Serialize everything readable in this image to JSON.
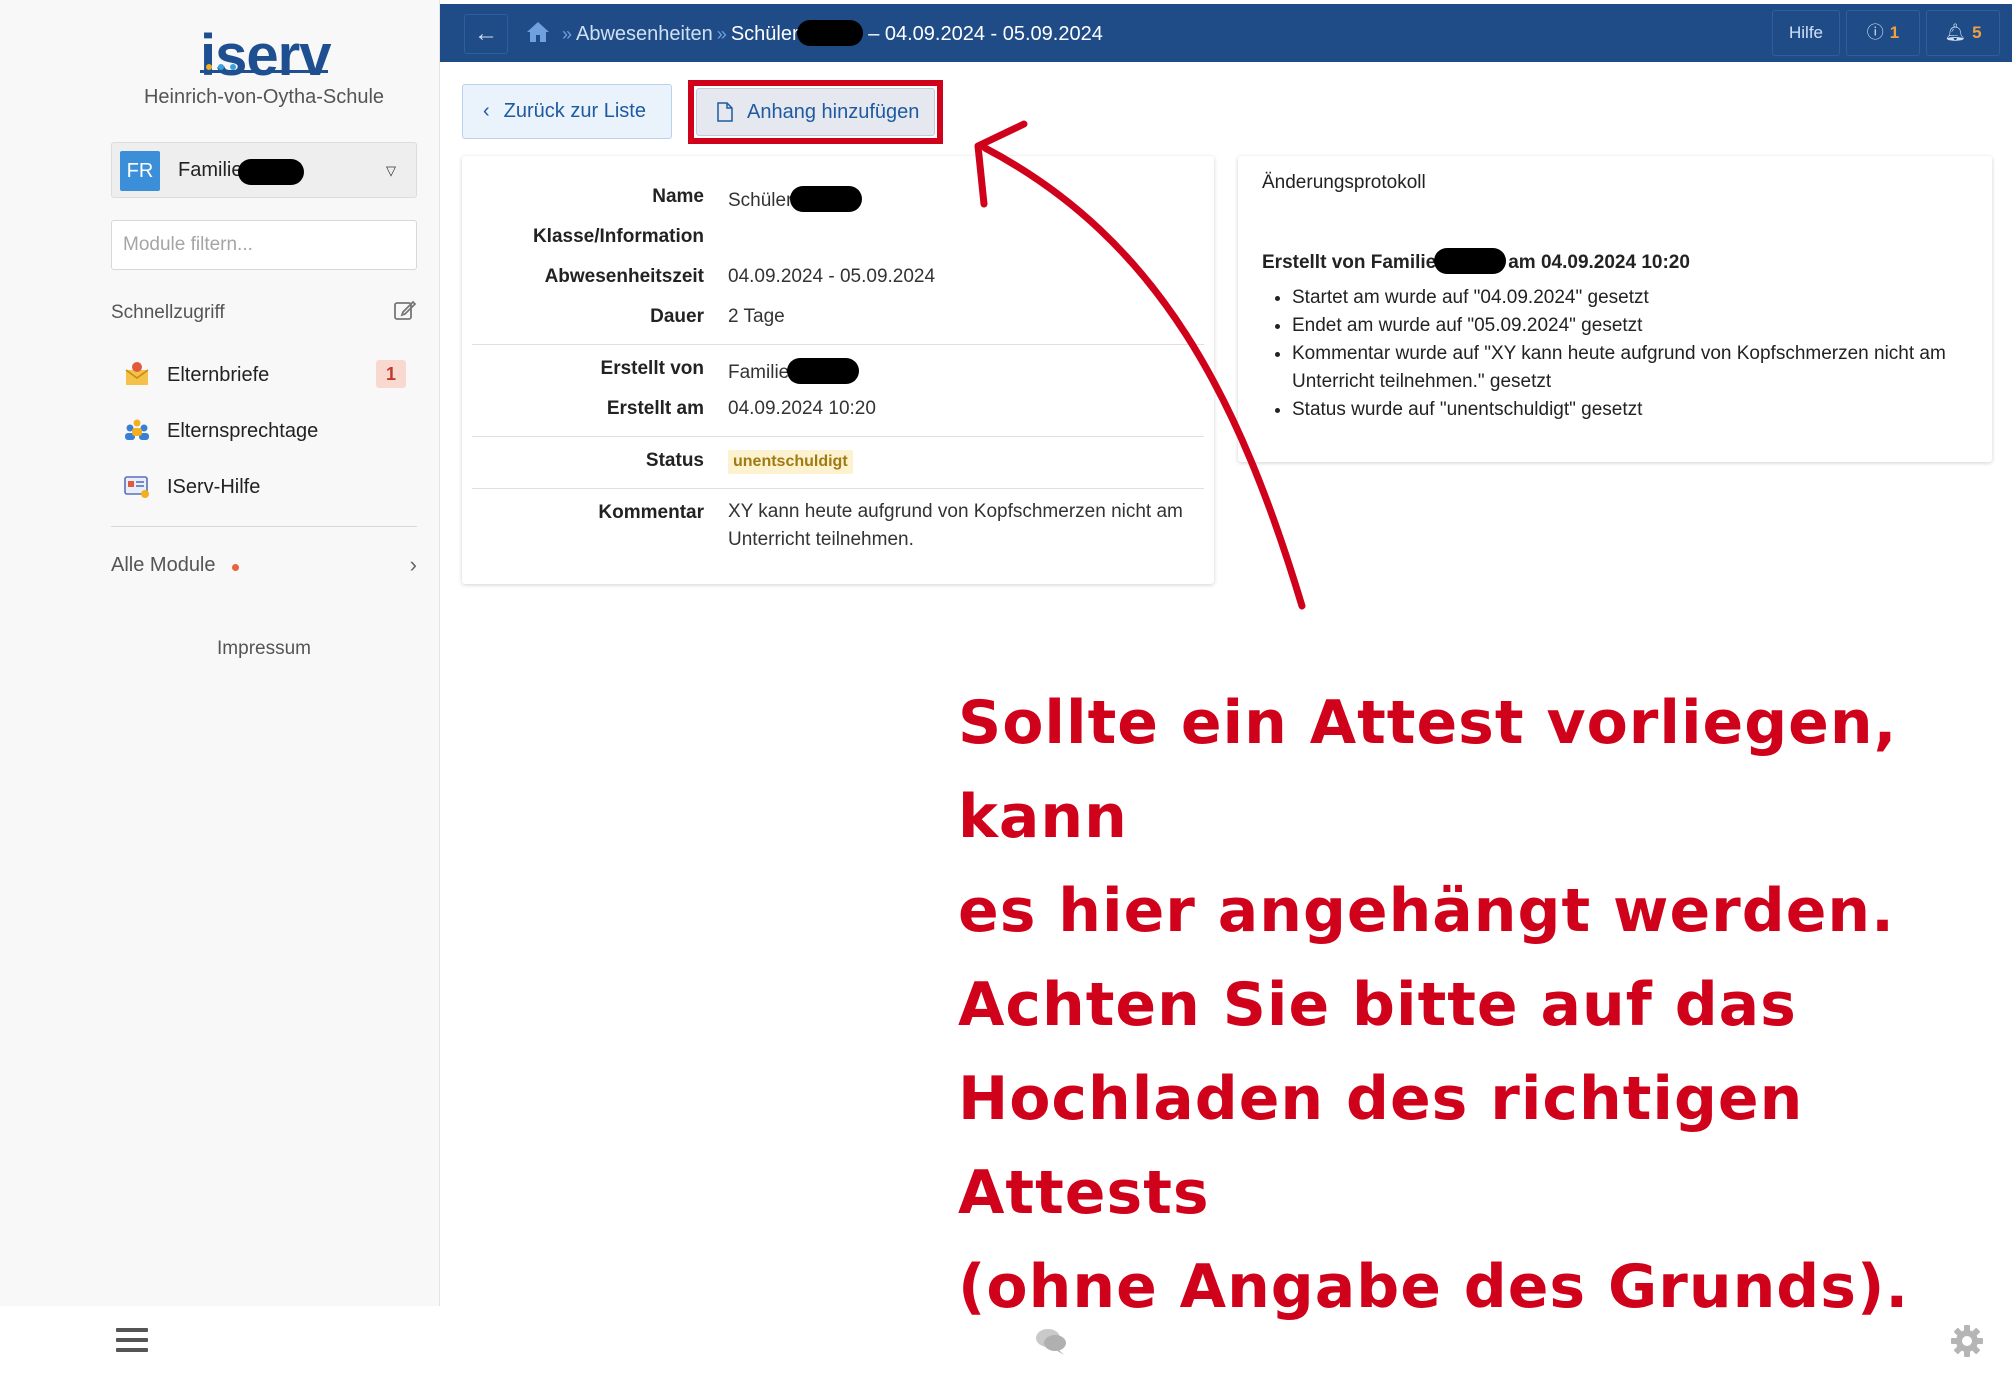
{
  "sidebar": {
    "logo": "iserv",
    "school": "Heinrich-von-Oytha-Schule",
    "account": {
      "initials": "FR",
      "name": "Familie"
    },
    "filter_placeholder": "Module filtern...",
    "quick_access_title": "Schnellzugriff",
    "items": [
      {
        "label": "Elternbriefe",
        "badge": "1",
        "icon": "letter-icon"
      },
      {
        "label": "Elternsprechtage",
        "icon": "people-icon"
      },
      {
        "label": "IServ-Hilfe",
        "icon": "help-icon"
      }
    ],
    "all_modules": "Alle Module",
    "impressum": "Impressum"
  },
  "topbar": {
    "crumb_module": "Abwesenheiten",
    "crumb_student": "Schüler",
    "crumb_dates": "– 04.09.2024 - 05.09.2024",
    "help": "Hilfe",
    "info_count": "1",
    "bell_count": "5"
  },
  "actions": {
    "back_label": "Zurück zur Liste",
    "attach_label": "Anhang hinzufügen"
  },
  "details": {
    "name_label": "Name",
    "name_value": "Schüler",
    "class_label": "Klasse/Information",
    "period_label": "Abwesenheitszeit",
    "period_value": "04.09.2024 - 05.09.2024",
    "duration_label": "Dauer",
    "duration_value": "2 Tage",
    "created_by_label": "Erstellt von",
    "created_by_value": "Familie",
    "created_at_label": "Erstellt am",
    "created_at_value": "04.09.2024 10:20",
    "status_label": "Status",
    "status_value": "unentschuldigt",
    "comment_label": "Kommentar",
    "comment_value": "XY kann heute aufgrund von Kopfschmerzen nicht am Unterricht teilnehmen."
  },
  "changelog": {
    "title": "Änderungsprotokoll",
    "head_prefix": "Erstellt von Familie",
    "head_suffix": "am 04.09.2024 10:20",
    "entries": [
      "Startet am wurde auf \"04.09.2024\" gesetzt",
      "Endet am wurde auf \"05.09.2024\" gesetzt",
      "Kommentar wurde auf \"XY kann heute aufgrund von Kopfschmerzen nicht am Unterricht teilnehmen.\" gesetzt",
      "Status wurde auf \"unentschuldigt\" gesetzt"
    ]
  },
  "annotation": {
    "lines": [
      "Sollte ein Attest vorliegen, kann",
      "es hier angehängt werden.",
      "Achten Sie bitte auf das",
      "Hochladen des richtigen Attests",
      "(ohne Angabe des Grunds)."
    ],
    "color": "#d0021b"
  },
  "colors": {
    "topbar": "#1f4c86",
    "brand": "#1e4f91",
    "badge_bg": "#f9d8d0",
    "status_bg": "#fcf2cf"
  }
}
